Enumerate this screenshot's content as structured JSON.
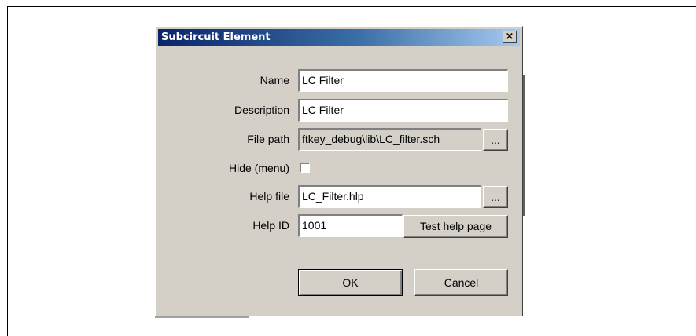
{
  "dialog": {
    "title": "Subcircuit Element",
    "close_label": "×"
  },
  "form": {
    "name": {
      "label": "Name",
      "value": "LC Filter"
    },
    "description": {
      "label": "Description",
      "value": "LC Filter"
    },
    "file_path": {
      "label": "File path",
      "value": "ftkey_debug\\lib\\LC_filter.sch",
      "browse_label": "..."
    },
    "hide_menu": {
      "label": "Hide (menu)",
      "checked": false
    },
    "help_file": {
      "label": "Help file",
      "value": "LC_Filter.hlp",
      "browse_label": "..."
    },
    "help_id": {
      "label": "Help ID",
      "value": "1001",
      "test_label": "Test help page"
    }
  },
  "buttons": {
    "ok_label": "OK",
    "cancel_label": "Cancel"
  }
}
